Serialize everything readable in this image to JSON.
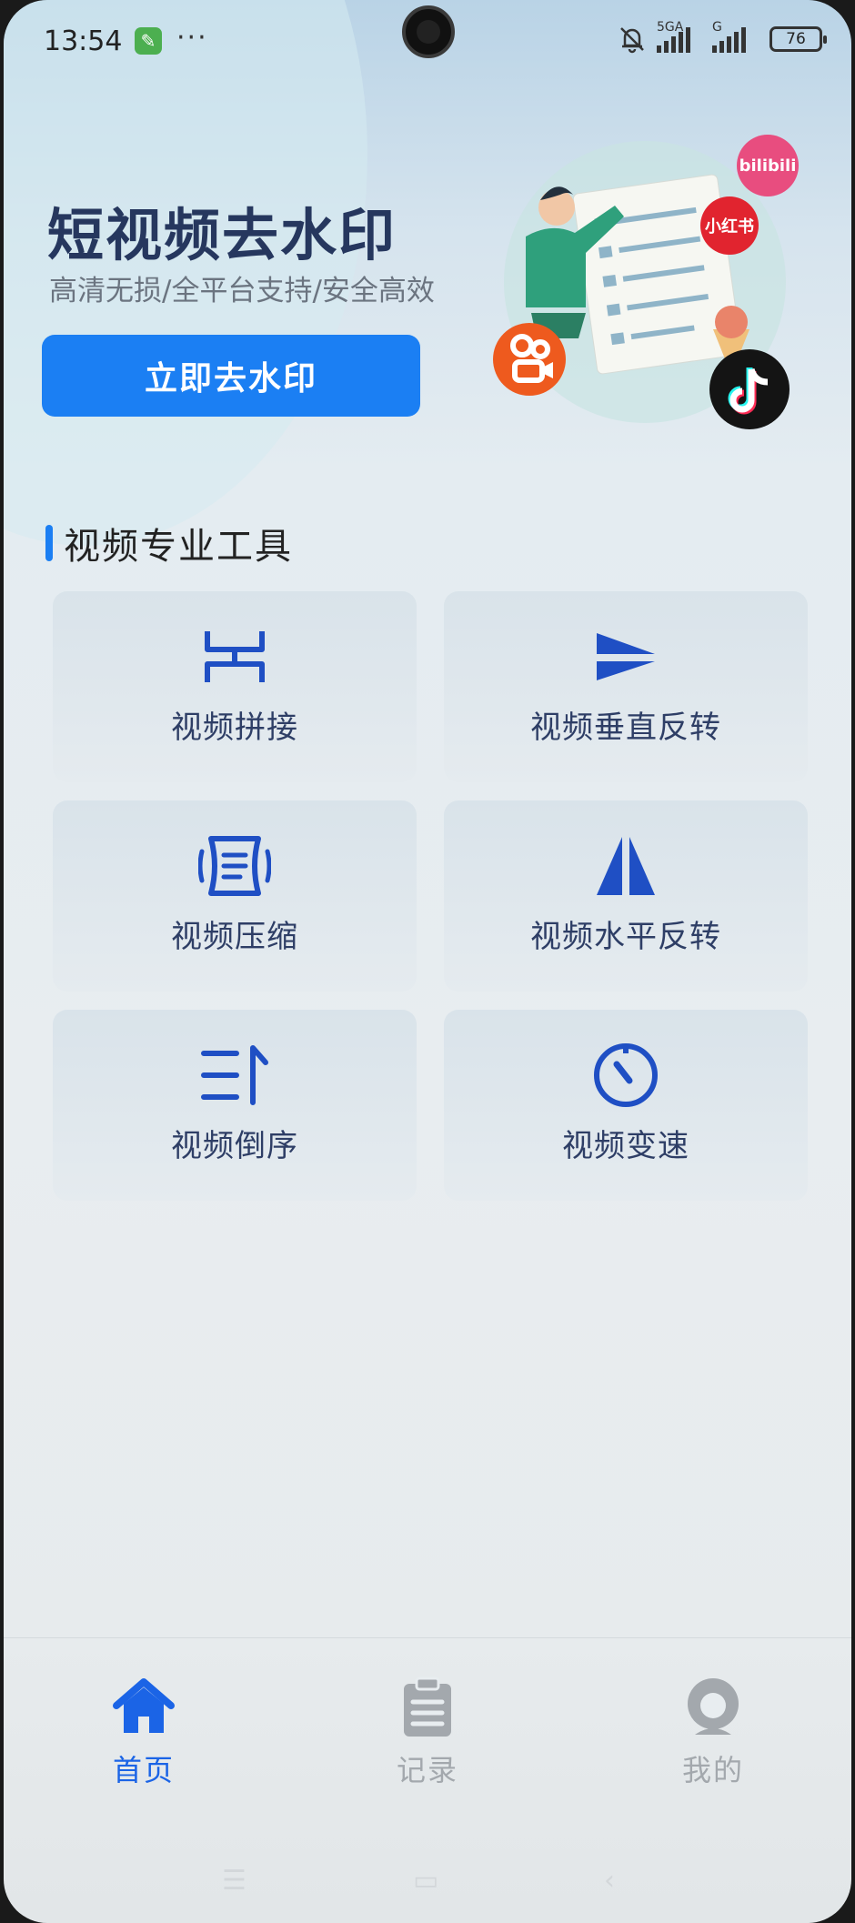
{
  "status_bar": {
    "time": "13:54",
    "network1": "5GA",
    "network2": "G",
    "battery": "76",
    "dots": "···"
  },
  "hero": {
    "title": "短视频去水印",
    "subtitle": "高清无损/全平台支持/安全高效",
    "button_label": "立即去水印",
    "platform_labels": {
      "bilibili": "bilibili",
      "xiaohongshu": "小红书"
    }
  },
  "tools_section": {
    "title": "视频专业工具",
    "items": [
      {
        "label": "视频拼接",
        "icon": "merge-icon"
      },
      {
        "label": "视频垂直反转",
        "icon": "vertical-flip-icon"
      },
      {
        "label": "视频压缩",
        "icon": "compress-icon"
      },
      {
        "label": "视频水平反转",
        "icon": "horizontal-flip-icon"
      },
      {
        "label": "视频倒序",
        "icon": "reverse-icon"
      },
      {
        "label": "视频变速",
        "icon": "speed-icon"
      }
    ]
  },
  "bottom_nav": {
    "items": [
      {
        "label": "首页",
        "icon": "home-icon",
        "active": true
      },
      {
        "label": "记录",
        "icon": "clipboard-icon",
        "active": false
      },
      {
        "label": "我的",
        "icon": "profile-icon",
        "active": false
      }
    ]
  },
  "colors": {
    "accent": "#1b7ff3",
    "title": "#26375e",
    "icon_blue": "#1f4fc4",
    "inactive": "#a3a8ad"
  }
}
